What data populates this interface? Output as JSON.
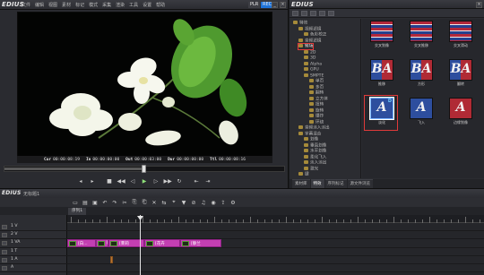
{
  "app": {
    "brand": "EDIUS",
    "plr_label": "PLR",
    "rec_label": "REC",
    "menu": [
      "文件",
      "编辑",
      "视图",
      "素材",
      "标记",
      "模式",
      "采集",
      "渲染",
      "工具",
      "设置",
      "帮助"
    ]
  },
  "player": {
    "timecodes": [
      {
        "label": "Cur",
        "value": "00:00:08:19"
      },
      {
        "label": "In",
        "value": "00:00:00:00"
      },
      {
        "label": "Out",
        "value": "00:00:03:00"
      },
      {
        "label": "Dur",
        "value": "00:00:00:00"
      },
      {
        "label": "Ttl",
        "value": "00:00:08:16"
      }
    ],
    "scrub_progress": 0.5,
    "transport_icons": [
      "set-in-icon",
      "set-out-icon",
      "stop-icon",
      "rewind-icon",
      "step-back-icon",
      "play-icon",
      "step-forward-icon",
      "fast-forward-icon",
      "loop-icon",
      "insert-icon",
      "overwrite-icon"
    ],
    "colors": {
      "play": "#8fe07a",
      "highlight": "#e03a3a",
      "accent_blue": "#1f73d8"
    }
  },
  "effects_panel": {
    "brand": "EDIUS",
    "tree": [
      {
        "label": "特效",
        "depth": 0
      },
      {
        "label": "视频滤镜",
        "depth": 1
      },
      {
        "label": "色彩校正",
        "depth": 2
      },
      {
        "label": "音频滤镜",
        "depth": 1
      },
      {
        "label": "转场",
        "depth": 1,
        "selected": true
      },
      {
        "label": "2D",
        "depth": 2
      },
      {
        "label": "3D",
        "depth": 2
      },
      {
        "label": "Alpha",
        "depth": 2
      },
      {
        "label": "GPU",
        "depth": 2
      },
      {
        "label": "SMPTE",
        "depth": 2
      },
      {
        "label": "单页",
        "depth": 3
      },
      {
        "label": "多页",
        "depth": 3
      },
      {
        "label": "翻转",
        "depth": 3
      },
      {
        "label": "立方体",
        "depth": 3
      },
      {
        "label": "扭转",
        "depth": 3
      },
      {
        "label": "旋转",
        "depth": 3
      },
      {
        "label": "爆炸",
        "depth": 3
      },
      {
        "label": "环绕",
        "depth": 3
      },
      {
        "label": "音频淡入淡出",
        "depth": 1
      },
      {
        "label": "字幕混合",
        "depth": 1
      },
      {
        "label": "划像",
        "depth": 2
      },
      {
        "label": "垂直划像",
        "depth": 2
      },
      {
        "label": "水平划像",
        "depth": 2
      },
      {
        "label": "柔化飞入",
        "depth": 2
      },
      {
        "label": "淡入淡出",
        "depth": 2
      },
      {
        "label": "激光",
        "depth": 2
      },
      {
        "label": "键",
        "depth": 1
      }
    ],
    "thumbnails": [
      {
        "label": "交叉划像",
        "glyph": "",
        "style": "stripes"
      },
      {
        "label": "交叉推移",
        "glyph": "",
        "style": "stripes"
      },
      {
        "label": "交叉滑动",
        "glyph": "",
        "style": "stripes"
      },
      {
        "label": "推移",
        "glyph": "BA",
        "style": "letters"
      },
      {
        "label": "方形",
        "glyph": "BA",
        "style": "letters"
      },
      {
        "label": "翻转",
        "glyph": "BA",
        "style": "letters"
      },
      {
        "label": "淡化",
        "glyph": "A",
        "style": "selected",
        "badge": "D"
      },
      {
        "label": "飞入",
        "glyph": "A",
        "style": "letter"
      },
      {
        "label": "边缘划像",
        "glyph": "A",
        "style": "letter"
      }
    ],
    "tabs": [
      "素材库",
      "特效",
      "序列标记",
      "源文件浏览"
    ]
  },
  "timeline": {
    "brand": "EDIUS",
    "project_label": "无标题1",
    "sequence_tab": "序列1",
    "tracks": [
      {
        "name": "1 V",
        "type": "video"
      },
      {
        "name": "2 V",
        "type": "video"
      },
      {
        "name": "1 VA",
        "type": "va"
      },
      {
        "name": "1 T",
        "type": "title"
      },
      {
        "name": "1 A",
        "type": "audio"
      },
      {
        "name": "A",
        "type": "audio"
      }
    ],
    "clips": [
      {
        "label": "[白...",
        "kind": "video"
      },
      {
        "label": "[...",
        "kind": "video"
      },
      {
        "label": "[茉莉",
        "kind": "video"
      },
      {
        "label": "[花卉",
        "kind": "video"
      },
      {
        "label": "[静兰",
        "kind": "video"
      }
    ]
  }
}
